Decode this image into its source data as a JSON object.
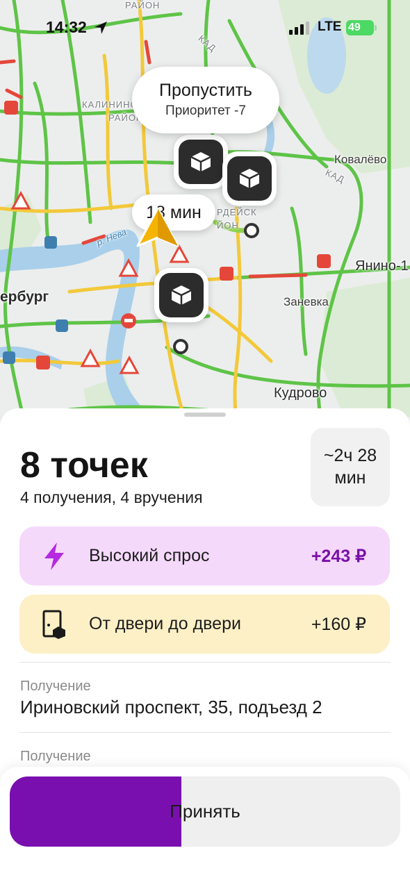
{
  "status_bar": {
    "time": "14:32",
    "network": "LTE",
    "battery": "49"
  },
  "map": {
    "labels": {
      "kad_top": "КАД",
      "kad_right": "КАД",
      "rayon_top": "РАЙОН",
      "kalininsky_1": "КАЛИНИНС",
      "kalininsky_2": "РАЙОН",
      "krasnogvard_1": "РДЕЙСК",
      "krasnogvard_2": "ЙОН",
      "kovalevo": "Ковалёво",
      "yanino": "Янино-1",
      "zanevka": "Заневка",
      "kudrovo": "Кудрово",
      "spb": "ербург",
      "neva": "р. Нева"
    },
    "bubble": {
      "title": "Пропустить",
      "subtitle": "Приоритет -7"
    },
    "eta": "18 мин"
  },
  "order": {
    "title": "8 точек",
    "subtitle": "4 получения, 4 вручения",
    "duration": "~2ч 28 мин"
  },
  "bonuses": [
    {
      "label": "Высокий спрос",
      "amount": "+243 ₽",
      "icon": "lightning-icon",
      "color": "#f5d9fb"
    },
    {
      "label": "От двери до двери",
      "amount": "+160 ₽",
      "icon": "door-box-icon",
      "color": "#fdf0c6"
    }
  ],
  "points": [
    {
      "type": "Получение",
      "address": "Ириновский проспект, 35, подъезд 2"
    },
    {
      "type": "Получение"
    }
  ],
  "accept": {
    "label": "Принять",
    "progress": 0.44,
    "accent": "#7a0fb0"
  }
}
